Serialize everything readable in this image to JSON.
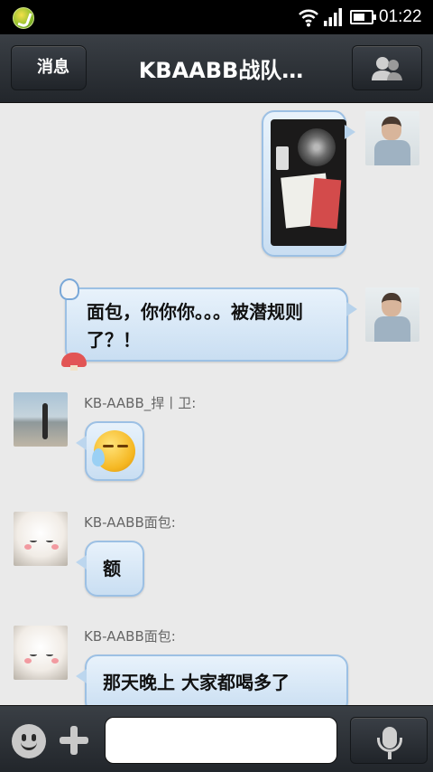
{
  "status_bar": {
    "time": "01:22"
  },
  "title_bar": {
    "back_label": "消息",
    "title": "KBAABB战队…"
  },
  "messages": [
    {
      "id": 1,
      "side": "right",
      "type": "image",
      "sender": ""
    },
    {
      "id": 2,
      "side": "right",
      "type": "text",
      "sender": "",
      "text": "面包，你你你。。。被潜规则了？！"
    },
    {
      "id": 3,
      "side": "left",
      "type": "emoji",
      "sender": "KB-AABB_捍丨卫:"
    },
    {
      "id": 4,
      "side": "left",
      "type": "text",
      "sender": "KB-AABB面包:",
      "text": "额"
    },
    {
      "id": 5,
      "side": "left",
      "type": "text",
      "sender": "KB-AABB面包:",
      "text": "那天晚上 大家都喝多了"
    }
  ],
  "input": {
    "placeholder": ""
  },
  "icons": {
    "app": "app-icon",
    "wifi": "wifi-icon",
    "signal": "signal-icon",
    "battery": "battery-icon",
    "group": "group-members-icon",
    "emoji": "smiley-icon",
    "plus": "plus-icon",
    "mic": "microphone-icon"
  },
  "colors": {
    "bubble_fill": "#d8e8f7",
    "bubble_border": "#9cc0e4",
    "bar": "#2b3035",
    "background": "#eaeaea"
  }
}
